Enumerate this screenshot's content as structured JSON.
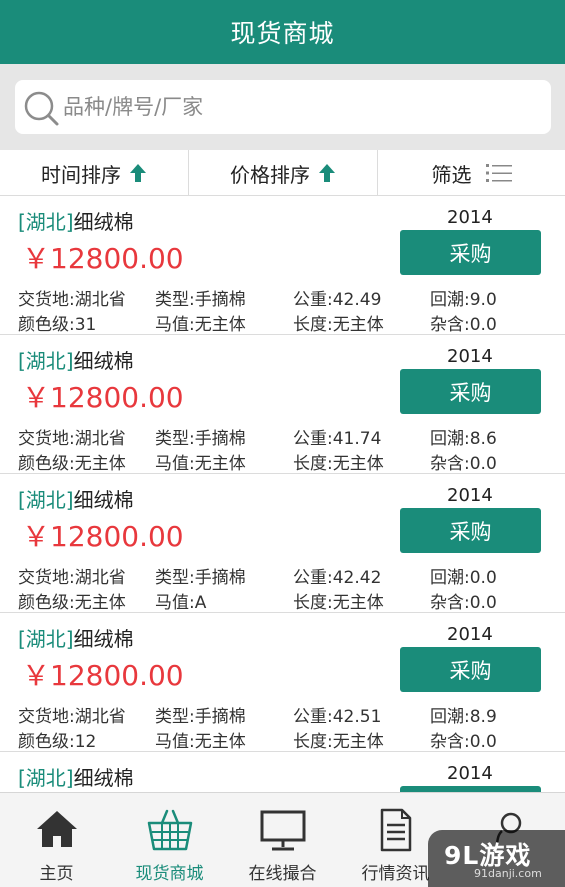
{
  "header": {
    "title": "现货商城"
  },
  "search": {
    "placeholder": "品种/牌号/厂家"
  },
  "sortbar": {
    "time_label": "时间排序",
    "price_label": "价格排序",
    "filter_label": "筛选"
  },
  "colors": {
    "accent": "#1a8c7a",
    "price": "#e8383d"
  },
  "items": [
    {
      "region": "[湖北]",
      "name": "细绒棉",
      "year": "2014",
      "price": "￥12800.00",
      "buy": "采购",
      "delivery": "交货地:湖北省",
      "type": "类型:手摘棉",
      "weight": "公重:42.49",
      "moisture": "回潮:9.0",
      "color_grade": "颜色级:31",
      "micronaire": "马值:无主体",
      "length": "长度:无主体",
      "impurity": "杂含:0.0"
    },
    {
      "region": "[湖北]",
      "name": "细绒棉",
      "year": "2014",
      "price": "￥12800.00",
      "buy": "采购",
      "delivery": "交货地:湖北省",
      "type": "类型:手摘棉",
      "weight": "公重:41.74",
      "moisture": "回潮:8.6",
      "color_grade": "颜色级:无主体",
      "micronaire": "马值:无主体",
      "length": "长度:无主体",
      "impurity": "杂含:0.0"
    },
    {
      "region": "[湖北]",
      "name": "细绒棉",
      "year": "2014",
      "price": "￥12800.00",
      "buy": "采购",
      "delivery": "交货地:湖北省",
      "type": "类型:手摘棉",
      "weight": "公重:42.42",
      "moisture": "回潮:0.0",
      "color_grade": "颜色级:无主体",
      "micronaire": "马值:A",
      "length": "长度:无主体",
      "impurity": "杂含:0.0"
    },
    {
      "region": "[湖北]",
      "name": "细绒棉",
      "year": "2014",
      "price": "￥12800.00",
      "buy": "采购",
      "delivery": "交货地:湖北省",
      "type": "类型:手摘棉",
      "weight": "公重:42.51",
      "moisture": "回潮:8.9",
      "color_grade": "颜色级:12",
      "micronaire": "马值:无主体",
      "length": "长度:无主体",
      "impurity": "杂含:0.0"
    },
    {
      "region": "[湖北]",
      "name": "细绒棉",
      "year": "2014"
    }
  ],
  "tabs": [
    {
      "label": "主页",
      "icon": "home-icon"
    },
    {
      "label": "现货商城",
      "icon": "basket-icon",
      "active": true
    },
    {
      "label": "在线撮合",
      "icon": "monitor-icon"
    },
    {
      "label": "行情资讯",
      "icon": "document-icon"
    },
    {
      "label": "",
      "icon": "profile-icon"
    }
  ],
  "watermark": {
    "main": "9L游戏",
    "sub": "91danji.com"
  }
}
